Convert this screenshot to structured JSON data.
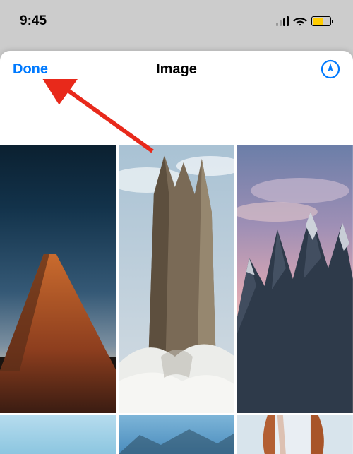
{
  "status_bar": {
    "time": "9:45"
  },
  "nav": {
    "done_label": "Done",
    "title": "Image"
  },
  "colors": {
    "accent": "#007aff",
    "arrow": "#e8291b",
    "battery_fill": "#ffcc00"
  }
}
